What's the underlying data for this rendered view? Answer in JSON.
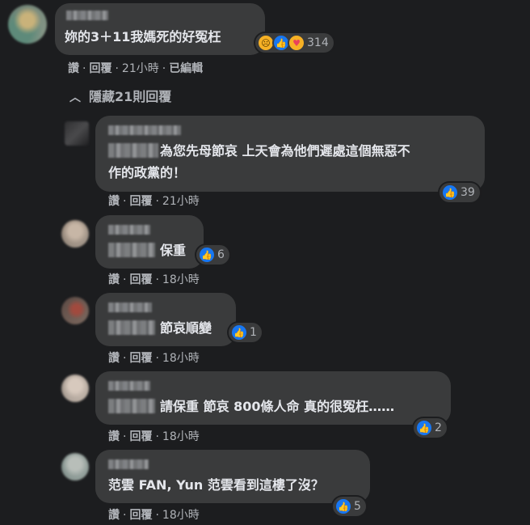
{
  "main_comment": {
    "text": "妳的3＋11我媽死的好冤枉",
    "reaction_icons": [
      "sad-icon",
      "like-icon",
      "care-icon"
    ],
    "reaction_count": "314",
    "like_label": "讚",
    "reply_label": "回覆",
    "time": "21小時",
    "edited_label": "已編輯"
  },
  "replies_toggle": {
    "label": "隱藏21則回覆"
  },
  "replies": [
    {
      "text_line1": "為您先母節哀 上天會為他們遲處這個無惡不",
      "text_line2": "作的政黨的！",
      "like_label": "讚",
      "reply_label": "回覆",
      "time": "21小時",
      "reaction_count": "39"
    },
    {
      "text_line1": "保重",
      "like_label": "讚",
      "reply_label": "回覆",
      "time": "18小時",
      "reaction_count": "6"
    },
    {
      "text_line1": "節哀順變",
      "like_label": "讚",
      "reply_label": "回覆",
      "time": "18小時",
      "reaction_count": "1"
    },
    {
      "text_line1": "請保重 節哀 800條人命 真的很冤枉……",
      "like_label": "讚",
      "reply_label": "回覆",
      "time": "18小時",
      "reaction_count": "2"
    },
    {
      "text_line1": "范雲 FAN, Yun 范雲看到這樓了沒？",
      "like_label": "讚",
      "reply_label": "回覆",
      "time": "18小時",
      "reaction_count": "5"
    }
  ],
  "colors": {
    "background": "#1c1d1f",
    "bubble": "#3a3b3c",
    "like_blue": "#1877f2",
    "secondary_text": "#b0b3b8"
  }
}
